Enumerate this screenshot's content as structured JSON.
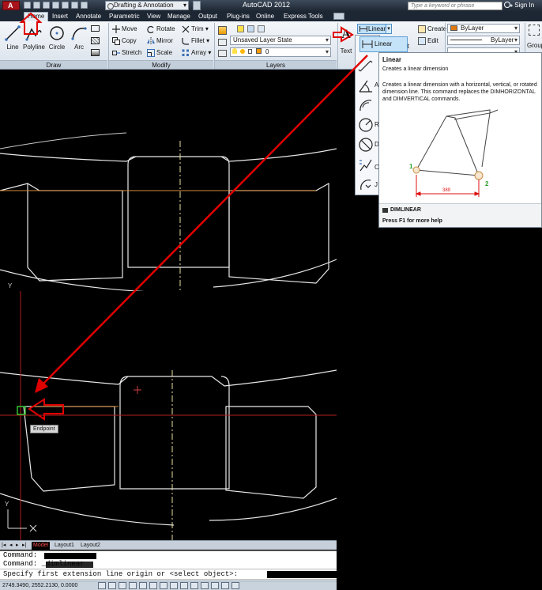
{
  "titlebar": {
    "workspace": "Drafting & Annotation",
    "app_title": "AutoCAD 2012",
    "search_placeholder": "Type a keyword or phrase",
    "sign_in": "Sign In"
  },
  "tabs": [
    "Home",
    "Insert",
    "Annotate",
    "Parametric",
    "View",
    "Manage",
    "Output",
    "Plug-ins",
    "Online",
    "Express Tools"
  ],
  "ribbon": {
    "draw": {
      "label": "Draw",
      "big_buttons": [
        "Line",
        "Polyline",
        "Circle",
        "Arc"
      ]
    },
    "modify": {
      "label": "Modify",
      "buttons": [
        "Move",
        "Rotate",
        "Trim",
        "Copy",
        "Mirror",
        "Fillet",
        "Stretch",
        "Scale",
        "Array"
      ]
    },
    "layers": {
      "label": "Layers",
      "layer_state": "Unsaved Layer State",
      "current_layer": "0"
    },
    "annotation": {
      "text_label": "Text",
      "dim_split_label": "Linear",
      "dim_highlight_label": "Linear"
    },
    "block": {
      "create": "Create",
      "edit": "Edit",
      "insert_partial": "rt"
    },
    "properties": {
      "color": "ByLayer",
      "linetype": "ByLayer"
    },
    "group_partial": "Group"
  },
  "dim_menu": {
    "items": [
      "",
      "A",
      "",
      "R",
      "D",
      "",
      "O",
      "J"
    ]
  },
  "tooltip": {
    "title": "Linear",
    "subtitle": "Creates a linear dimension",
    "description": "Creates a linear dimension with a horizontal, vertical, or rotated dimension line. This command replaces the DIMHORIZONTAL and DIMVERTICAL commands.",
    "point1": "1",
    "point2": "2",
    "dim_value": "389",
    "command": "DIMLINEAR",
    "help": "Press F1 for more help"
  },
  "viewport": {
    "axis_y_top": "Y",
    "axis_y_bottom": "Y",
    "axis_x_bottom": "X",
    "snap_tooltip": "Endpoint"
  },
  "layout_tabs": [
    "Model",
    "Layout1",
    "Layout2"
  ],
  "command_line": {
    "history": [
      "Command: ",
      "Command: _dimlinear"
    ],
    "prompt": "Specify first extension line origin or <select object>:"
  },
  "status": {
    "coordinates": "2749.3490, 2552.2130, 0.0000"
  },
  "colors": {
    "layer_swatch": "#ff9a00",
    "bylayer_swatch": "#e07a10",
    "annotation_arrow": "#e00000",
    "dim_point": "#2aa02a"
  }
}
